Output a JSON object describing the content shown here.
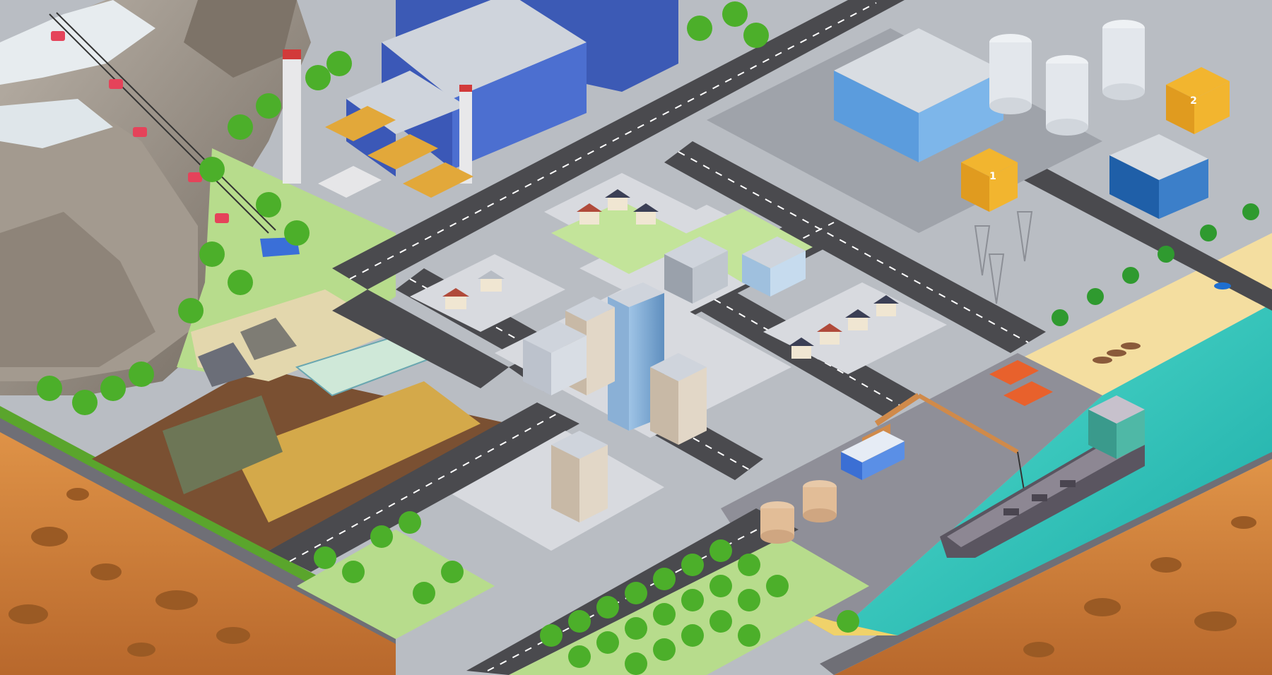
{
  "scene": {
    "colors": {
      "road": "#4a4a4e",
      "sidewalk": "#c9cdd3",
      "block": "#bfc3c9",
      "grass": "#b7dc8c",
      "water": "#2ec4b6",
      "sand": "#f4dea0",
      "soil": "#c97b3a",
      "mountain": "#8a7f72",
      "tree": "#4caf2a"
    },
    "labels": {
      "power_unit_1": "1",
      "power_unit_2": "2"
    }
  }
}
